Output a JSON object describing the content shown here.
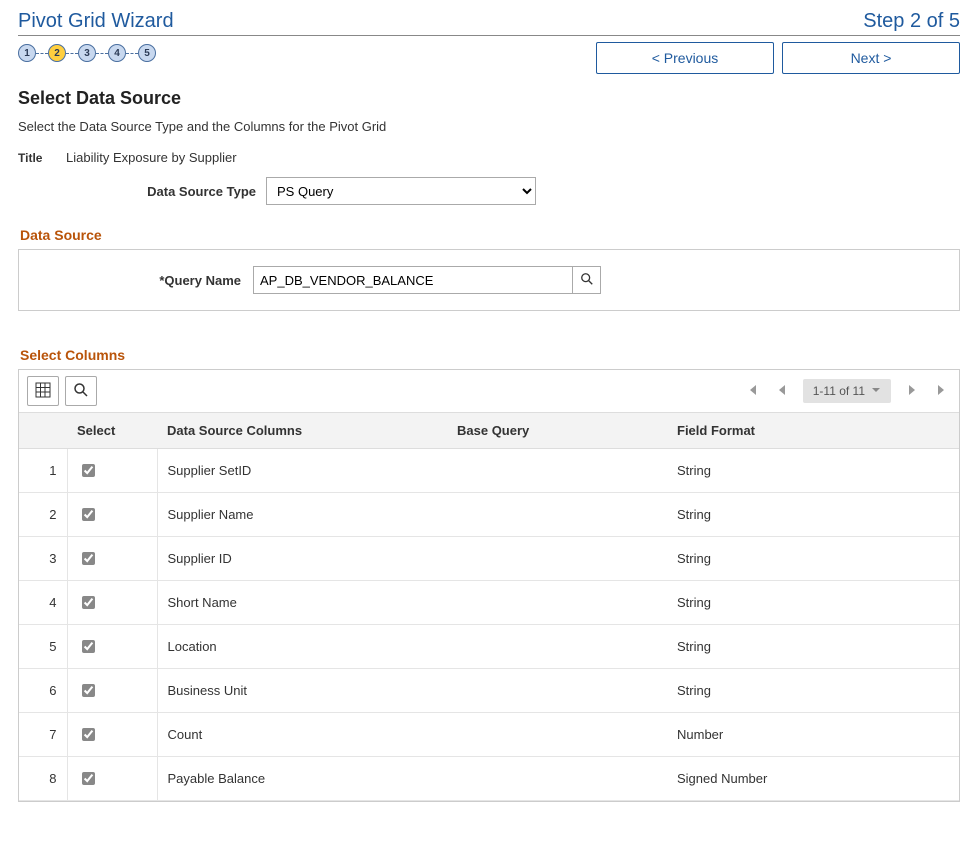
{
  "header": {
    "title": "Pivot Grid Wizard",
    "stepIndicator": "Step 2 of 5"
  },
  "stepTrain": {
    "steps": [
      "1",
      "2",
      "3",
      "4",
      "5"
    ],
    "activeIndex": 1
  },
  "navButtons": {
    "previous": "< Previous",
    "next": "Next >"
  },
  "page": {
    "heading": "Select Data Source",
    "instruction": "Select the Data Source Type and the Columns for the Pivot Grid",
    "titleLabel": "Title",
    "titleValue": "Liability Exposure by Supplier",
    "dataSourceTypeLabel": "Data Source Type",
    "dataSourceTypeValue": "PS Query"
  },
  "dataSource": {
    "sectionHead": "Data Source",
    "queryNameLabel": "*Query Name",
    "queryNameValue": "AP_DB_VENDOR_BALANCE"
  },
  "selectColumns": {
    "sectionHead": "Select Columns",
    "countLabel": "1-11 of 11",
    "headers": {
      "rownum": "",
      "select": "Select",
      "dataSourceColumns": "Data Source Columns",
      "baseQuery": "Base Query",
      "fieldFormat": "Field Format"
    },
    "rows": [
      {
        "n": "1",
        "selected": true,
        "column": "Supplier SetID",
        "baseQuery": "",
        "format": "String"
      },
      {
        "n": "2",
        "selected": true,
        "column": "Supplier Name",
        "baseQuery": "",
        "format": "String"
      },
      {
        "n": "3",
        "selected": true,
        "column": "Supplier ID",
        "baseQuery": "",
        "format": "String"
      },
      {
        "n": "4",
        "selected": true,
        "column": "Short Name",
        "baseQuery": "",
        "format": "String"
      },
      {
        "n": "5",
        "selected": true,
        "column": "Location",
        "baseQuery": "",
        "format": "String"
      },
      {
        "n": "6",
        "selected": true,
        "column": "Business Unit",
        "baseQuery": "",
        "format": "String"
      },
      {
        "n": "7",
        "selected": true,
        "column": "Count",
        "baseQuery": "",
        "format": "Number"
      },
      {
        "n": "8",
        "selected": true,
        "column": "Payable Balance",
        "baseQuery": "",
        "format": "Signed Number"
      }
    ]
  }
}
